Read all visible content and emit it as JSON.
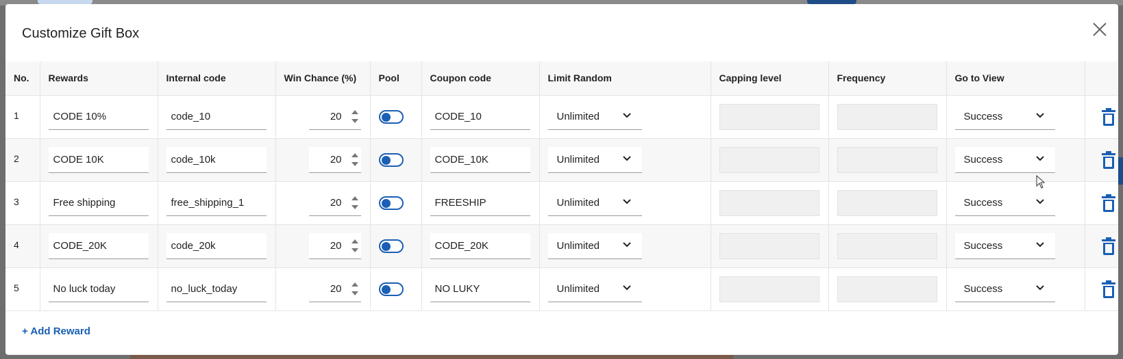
{
  "dialog": {
    "title": "Customize Gift Box",
    "add_reward_label": "+ Add Reward"
  },
  "columns": [
    "No.",
    "Rewards",
    "Internal code",
    "Win Chance (%)",
    "Pool",
    "Coupon code",
    "Limit Random",
    "Capping level",
    "Frequency",
    "Go to View",
    ""
  ],
  "rows": [
    {
      "no": "1",
      "reward": "CODE 10%",
      "internal_code": "code_10",
      "win_chance": "20",
      "pool_on": true,
      "coupon": "CODE_10",
      "limit_random": "Unlimited",
      "capping": "",
      "frequency": "",
      "view": "Success"
    },
    {
      "no": "2",
      "reward": "CODE 10K",
      "internal_code": "code_10k",
      "win_chance": "20",
      "pool_on": true,
      "coupon": "CODE_10K",
      "limit_random": "Unlimited",
      "capping": "",
      "frequency": "",
      "view": "Success"
    },
    {
      "no": "3",
      "reward": "Free shipping",
      "internal_code": "free_shipping_1",
      "win_chance": "20",
      "pool_on": true,
      "coupon": "FREESHIP",
      "limit_random": "Unlimited",
      "capping": "",
      "frequency": "",
      "view": "Success"
    },
    {
      "no": "4",
      "reward": "CODE_20K",
      "internal_code": "code_20k",
      "win_chance": "20",
      "pool_on": true,
      "coupon": "CODE_20K",
      "limit_random": "Unlimited",
      "capping": "",
      "frequency": "",
      "view": "Success"
    },
    {
      "no": "5",
      "reward": "No luck today",
      "internal_code": "no_luck_today",
      "win_chance": "20",
      "pool_on": true,
      "coupon": "NO LUKY",
      "limit_random": "Unlimited",
      "capping": "",
      "frequency": "",
      "view": "Success"
    }
  ],
  "icons": {
    "close": "close-icon",
    "delete": "trash-icon",
    "dropdown": "chevron-down-icon",
    "spinner_up": "caret-up-icon",
    "spinner_down": "caret-down-icon"
  },
  "colors": {
    "accent": "#1a5fb4",
    "header_bg": "#f7f7f7",
    "disabled_bg": "#f0f0f0"
  }
}
